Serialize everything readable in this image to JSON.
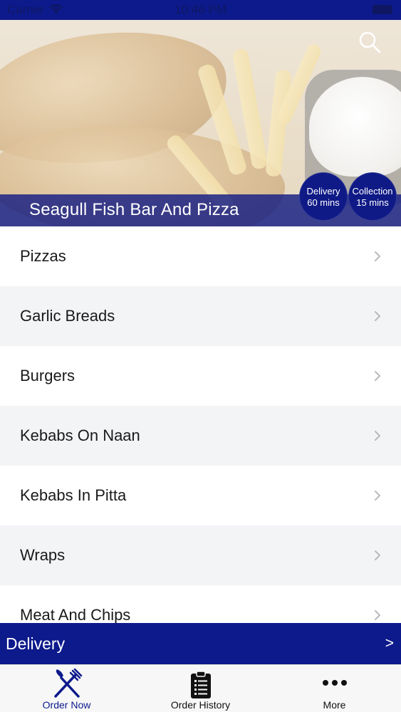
{
  "status_bar": {
    "carrier": "Carrier",
    "time": "10:46 PM"
  },
  "header": {
    "restaurant_name": "Seagull Fish Bar And Pizza",
    "delivery_badge": {
      "label": "Delivery",
      "time": "60 mins"
    },
    "collection_badge": {
      "label": "Collection",
      "time": "15 mins"
    }
  },
  "menu": {
    "categories": [
      {
        "label": "Pizzas"
      },
      {
        "label": "Garlic Breads"
      },
      {
        "label": "Burgers"
      },
      {
        "label": "Kebabs On Naan"
      },
      {
        "label": "Kebabs In Pitta"
      },
      {
        "label": "Wraps"
      },
      {
        "label": "Meat And Chips"
      }
    ]
  },
  "order_mode": {
    "label": "Delivery",
    "arrow": ">"
  },
  "tabs": [
    {
      "label": "Order Now",
      "icon": "fork-knife-icon"
    },
    {
      "label": "Order History",
      "icon": "clipboard-list-icon"
    },
    {
      "label": "More",
      "icon": "more-dots-icon"
    }
  ],
  "colors": {
    "brand": "#0d1a8c",
    "list_alt": "#f3f4f6"
  }
}
